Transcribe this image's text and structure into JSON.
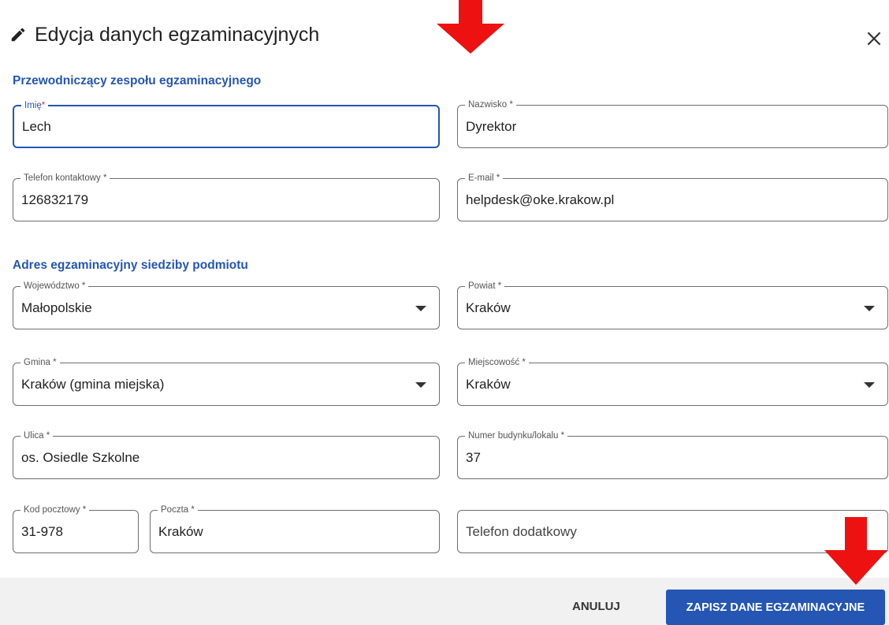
{
  "dialog": {
    "title": "Edycja danych egzaminacyjnych",
    "title_icon": "pencil-icon",
    "close_icon": "close-icon"
  },
  "chair_section": {
    "title": "Przewodniczący zespołu egzaminacyjnego",
    "first_name": {
      "label": "Imię",
      "required": "*",
      "value": "Lech"
    },
    "last_name": {
      "label": "Nazwisko *",
      "value": "Dyrektor"
    },
    "phone": {
      "label": "Telefon kontaktowy *",
      "value": "126832179"
    },
    "email": {
      "label": "E-mail *",
      "value": "helpdesk@oke.krakow.pl"
    }
  },
  "address_section": {
    "title": "Adres egzaminacyjny siedziby podmiotu",
    "voivodeship": {
      "label": "Województwo *",
      "value": "Małopolskie"
    },
    "county": {
      "label": "Powiat *",
      "value": "Kraków"
    },
    "commune": {
      "label": "Gmina *",
      "value": "Kraków (gmina miejska)"
    },
    "locality": {
      "label": "Miejscowość *",
      "value": "Kraków"
    },
    "street": {
      "label": "Ulica *",
      "value": "os. Osiedle Szkolne"
    },
    "building_number": {
      "label": "Numer budynku/lokalu *",
      "value": "37"
    },
    "postal_code": {
      "label": "Kod pocztowy *",
      "value": "31-978"
    },
    "post_office": {
      "label": "Poczta *",
      "value": "Kraków"
    },
    "extra_phone": {
      "placeholder": "Telefon dodatkowy",
      "value": ""
    }
  },
  "footer": {
    "cancel_label": "ANULUJ",
    "save_label": "ZAPISZ DANE EGZAMINACYJNE"
  },
  "colors": {
    "accent": "#2556b3",
    "required": "#d32f2f",
    "annotation_arrow": "#ee1111"
  }
}
